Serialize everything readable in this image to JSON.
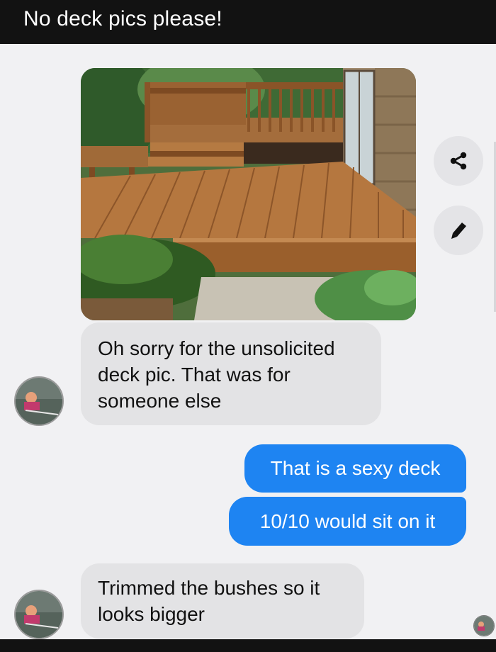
{
  "header": {
    "title": "No deck pics please!"
  },
  "messages": {
    "incoming_1": {
      "lines": [
        "Oh sorry for the unsolicited",
        "deck pic. That was for",
        "someone else"
      ]
    },
    "outgoing_1": {
      "text": "That is a sexy deck"
    },
    "outgoing_2": {
      "text": "10/10 would sit on it"
    },
    "incoming_2": {
      "lines": [
        "Trimmed the bushes so it",
        "looks bigger"
      ]
    }
  },
  "icons": {
    "share": "share-icon",
    "edit": "pencil-icon"
  },
  "colors": {
    "header_bg": "#121212",
    "chat_bg": "#f1f1f3",
    "outgoing_bubble": "#1e84f2",
    "incoming_bubble": "#e3e3e5"
  }
}
